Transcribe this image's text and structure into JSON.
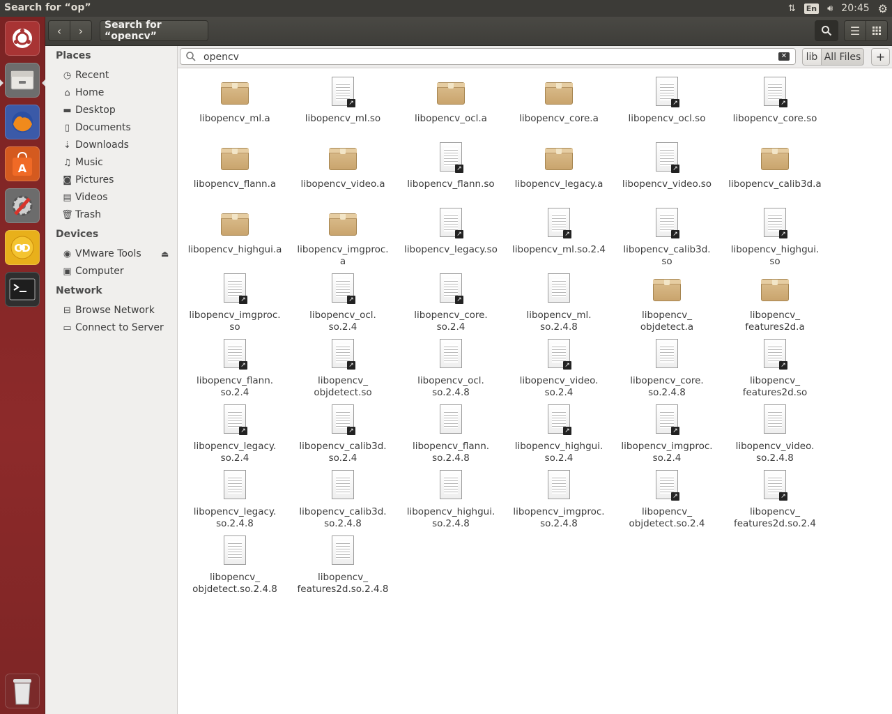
{
  "panel": {
    "title": "Search for “op”",
    "keyboard": "En",
    "clock": "20:45"
  },
  "toolbar": {
    "path_label": "Search for “opencv”"
  },
  "sidebar": {
    "places_header": "Places",
    "places": [
      {
        "label": "Recent",
        "icon": "clock-icon"
      },
      {
        "label": "Home",
        "icon": "home-icon"
      },
      {
        "label": "Desktop",
        "icon": "folder-icon"
      },
      {
        "label": "Documents",
        "icon": "document-icon"
      },
      {
        "label": "Downloads",
        "icon": "download-icon"
      },
      {
        "label": "Music",
        "icon": "music-icon"
      },
      {
        "label": "Pictures",
        "icon": "camera-icon"
      },
      {
        "label": "Videos",
        "icon": "film-icon"
      },
      {
        "label": "Trash",
        "icon": "trash-icon"
      }
    ],
    "devices_header": "Devices",
    "devices": [
      {
        "label": "VMware Tools",
        "icon": "disc-icon"
      },
      {
        "label": "Computer",
        "icon": "drive-icon"
      }
    ],
    "network_header": "Network",
    "network": [
      {
        "label": "Browse Network",
        "icon": "network-icon"
      },
      {
        "label": "Connect to Server",
        "icon": "server-icon"
      }
    ]
  },
  "search": {
    "value": "opencv",
    "scope_lib": "lib",
    "scope_all": "All Files",
    "add_label": "+"
  },
  "files": [
    {
      "label": "libopencv_ml.a",
      "type": "archive"
    },
    {
      "label": "libopencv_ml.so",
      "type": "link"
    },
    {
      "label": "libopencv_ocl.a",
      "type": "archive"
    },
    {
      "label": "libopencv_core.a",
      "type": "archive"
    },
    {
      "label": "libopencv_ocl.so",
      "type": "link"
    },
    {
      "label": "libopencv_core.so",
      "type": "link"
    },
    {
      "label": "libopencv_flann.a",
      "type": "archive"
    },
    {
      "label": "libopencv_video.a",
      "type": "archive"
    },
    {
      "label": "libopencv_flann.so",
      "type": "link"
    },
    {
      "label": "libopencv_legacy.a",
      "type": "archive"
    },
    {
      "label": "libopencv_video.so",
      "type": "link"
    },
    {
      "label": "libopencv_calib3d.a",
      "type": "archive"
    },
    {
      "label": "libopencv_highgui.a",
      "type": "archive"
    },
    {
      "label": "libopencv_imgproc.\na",
      "type": "archive"
    },
    {
      "label": "libopencv_legacy.so",
      "type": "link"
    },
    {
      "label": "libopencv_ml.so.2.4",
      "type": "link"
    },
    {
      "label": "libopencv_calib3d.\nso",
      "type": "link"
    },
    {
      "label": "libopencv_highgui.\nso",
      "type": "link"
    },
    {
      "label": "libopencv_imgproc.\nso",
      "type": "link"
    },
    {
      "label": "libopencv_ocl.\nso.2.4",
      "type": "link"
    },
    {
      "label": "libopencv_core.\nso.2.4",
      "type": "link"
    },
    {
      "label": "libopencv_ml.\nso.2.4.8",
      "type": "file"
    },
    {
      "label": "libopencv_\nobjdetect.a",
      "type": "archive"
    },
    {
      "label": "libopencv_\nfeatures2d.a",
      "type": "archive"
    },
    {
      "label": "libopencv_flann.\nso.2.4",
      "type": "link"
    },
    {
      "label": "libopencv_\nobjdetect.so",
      "type": "link"
    },
    {
      "label": "libopencv_ocl.\nso.2.4.8",
      "type": "file"
    },
    {
      "label": "libopencv_video.\nso.2.4",
      "type": "link"
    },
    {
      "label": "libopencv_core.\nso.2.4.8",
      "type": "file"
    },
    {
      "label": "libopencv_\nfeatures2d.so",
      "type": "link"
    },
    {
      "label": "libopencv_legacy.\nso.2.4",
      "type": "link"
    },
    {
      "label": "libopencv_calib3d.\nso.2.4",
      "type": "link"
    },
    {
      "label": "libopencv_flann.\nso.2.4.8",
      "type": "file"
    },
    {
      "label": "libopencv_highgui.\nso.2.4",
      "type": "link"
    },
    {
      "label": "libopencv_imgproc.\nso.2.4",
      "type": "link"
    },
    {
      "label": "libopencv_video.\nso.2.4.8",
      "type": "file"
    },
    {
      "label": "libopencv_legacy.\nso.2.4.8",
      "type": "file"
    },
    {
      "label": "libopencv_calib3d.\nso.2.4.8",
      "type": "file"
    },
    {
      "label": "libopencv_highgui.\nso.2.4.8",
      "type": "file"
    },
    {
      "label": "libopencv_imgproc.\nso.2.4.8",
      "type": "file"
    },
    {
      "label": "libopencv_\nobjdetect.so.2.4",
      "type": "link"
    },
    {
      "label": "libopencv_\nfeatures2d.so.2.4",
      "type": "link"
    },
    {
      "label": "libopencv_\nobjdetect.so.2.4.8",
      "type": "file"
    },
    {
      "label": "libopencv_\nfeatures2d.so.2.4.8",
      "type": "file"
    }
  ],
  "colors": {
    "panel": "#3c3b37",
    "launcher": "#8d2a2a",
    "sidebar": "#f0efed"
  }
}
